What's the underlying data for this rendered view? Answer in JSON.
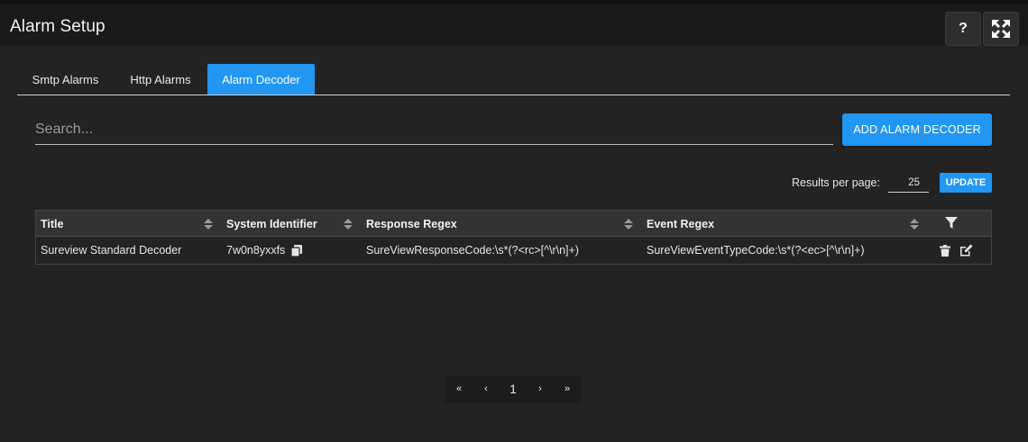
{
  "header": {
    "title": "Alarm Setup",
    "help_label": "?",
    "fullscreen_icon": "fullscreen-icon"
  },
  "tabs": [
    {
      "label": "Smtp Alarms",
      "active": false
    },
    {
      "label": "Http Alarms",
      "active": false
    },
    {
      "label": "Alarm Decoder",
      "active": true
    }
  ],
  "search": {
    "placeholder": "Search...",
    "value": ""
  },
  "toolbar": {
    "add_label": "ADD ALARM DECODER",
    "results_label": "Results per page:",
    "results_value": "25",
    "update_label": "UPDATE"
  },
  "colors": {
    "accent": "#2196f3",
    "background": "#232323",
    "header": "#1a1a1a"
  },
  "table": {
    "columns": [
      "Title",
      "System Identifier",
      "Response Regex",
      "Event Regex"
    ],
    "rows": [
      {
        "title": "Sureview Standard Decoder",
        "system_identifier": "7w0n8yxxfs",
        "response_regex": "SureViewResponseCode:\\s*(?<rc>[^\\r\\n]+)",
        "event_regex": "SureViewEventTypeCode:\\s*(?<ec>[^\\r\\n]+)"
      }
    ]
  },
  "pagination": {
    "first": "«",
    "prev": "‹",
    "current": "1",
    "next": "›",
    "last": "»"
  }
}
